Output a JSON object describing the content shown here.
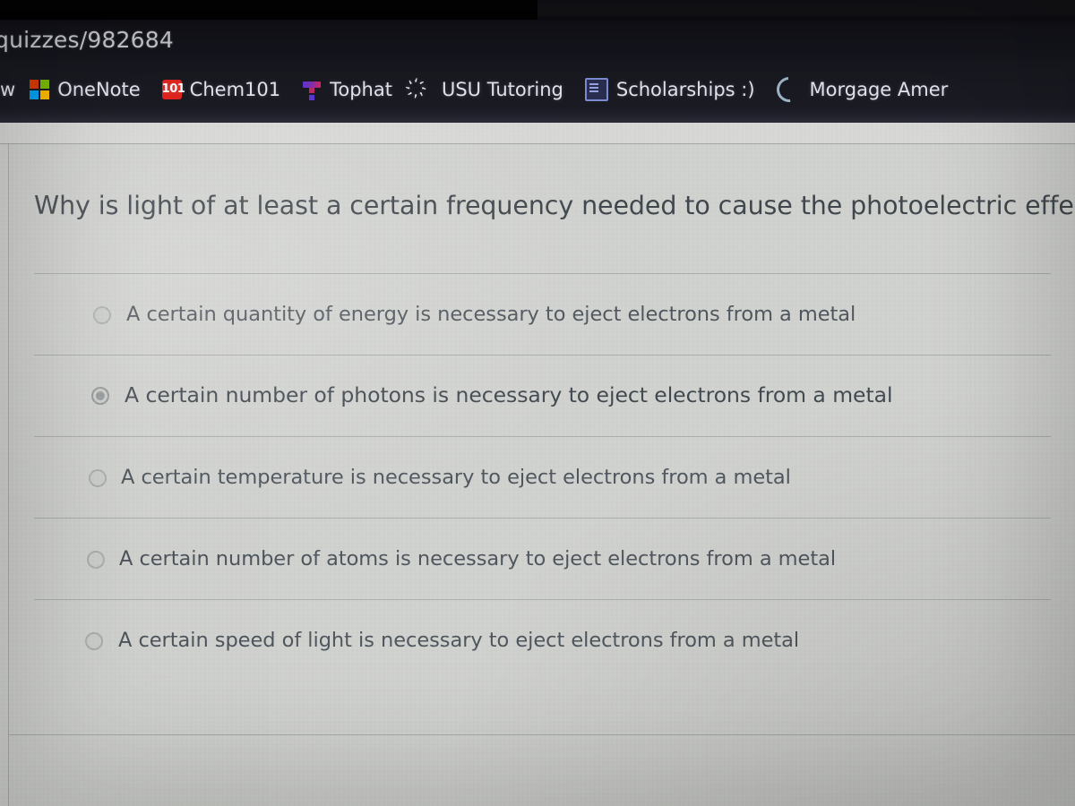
{
  "browser": {
    "url_fragment": "quizzes/982684",
    "bookmarks": [
      {
        "label": "w",
        "icon": "window-icon"
      },
      {
        "label": "OneNote",
        "icon": "microsoft-onenote-icon"
      },
      {
        "label": "Chem101",
        "icon": "chem101-icon",
        "icon_text": "101"
      },
      {
        "label": "Tophat",
        "icon": "tophat-icon"
      },
      {
        "label": "USU Tutoring",
        "icon": "people-group-icon",
        "icon_text": "҉"
      },
      {
        "label": "Scholarships :)",
        "icon": "document-icon"
      },
      {
        "label": "Morgage Amer",
        "icon": "loading-spinner-icon"
      }
    ]
  },
  "quiz": {
    "question": "Why is light of at least a certain frequency needed to cause the photoelectric effect?",
    "answers": [
      {
        "label": "A certain quantity of energy is necessary to eject electrons from a metal",
        "selected": false
      },
      {
        "label": "A certain number of photons is necessary to eject electrons from a metal",
        "selected": true
      },
      {
        "label": "A certain temperature is necessary to eject electrons from a metal",
        "selected": false
      },
      {
        "label": "A certain number of atoms is necessary to eject electrons from a metal",
        "selected": false
      },
      {
        "label": "A certain speed of light is necessary to eject electrons from a metal",
        "selected": false
      }
    ]
  },
  "colors": {
    "chrome_bg": "#14141b",
    "page_bg": "#cfd0cd",
    "question_text": "#3b4147",
    "answer_text": "#4a5057",
    "divider": "#9ea2a1",
    "bookmark_text": "#e6e8ee"
  }
}
